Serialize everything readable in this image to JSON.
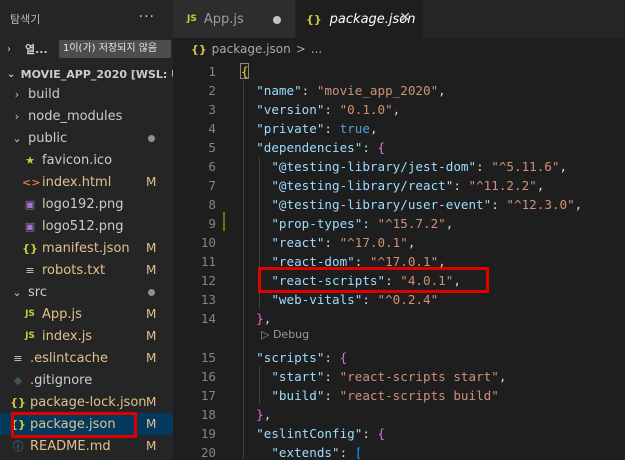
{
  "sidebar": {
    "title": "탐색기",
    "more": "···",
    "open_editors": {
      "label": "열...",
      "badge": "1이(가) 저장되지 않음"
    },
    "project": "MOVIE_APP_2020 [WSL: U...",
    "items": [
      {
        "name": "build",
        "chev": "›",
        "icon": "",
        "status": ""
      },
      {
        "name": "node_modules",
        "chev": "›",
        "icon": "",
        "status": ""
      },
      {
        "name": "public",
        "chev": "⌄",
        "icon": "",
        "status": ""
      },
      {
        "name": "favicon.ico",
        "chev": "",
        "icon": "★",
        "status": ""
      },
      {
        "name": "index.html",
        "chev": "",
        "icon": "<>",
        "status": "M"
      },
      {
        "name": "logo192.png",
        "chev": "",
        "icon": "▣",
        "status": ""
      },
      {
        "name": "logo512.png",
        "chev": "",
        "icon": "▣",
        "status": ""
      },
      {
        "name": "manifest.json",
        "chev": "",
        "icon": "{}",
        "status": "M"
      },
      {
        "name": "robots.txt",
        "chev": "",
        "icon": "≡",
        "status": "M"
      },
      {
        "name": "src",
        "chev": "⌄",
        "icon": "",
        "status": ""
      },
      {
        "name": "App.js",
        "chev": "",
        "icon": "JS",
        "status": "M"
      },
      {
        "name": "index.js",
        "chev": "",
        "icon": "JS",
        "status": "M"
      },
      {
        "name": ".eslintcache",
        "chev": "",
        "icon": "≡",
        "status": "M"
      },
      {
        "name": ".gitignore",
        "chev": "",
        "icon": "◆",
        "status": ""
      },
      {
        "name": "package-lock.json",
        "chev": "",
        "icon": "{}",
        "status": "M"
      },
      {
        "name": "package.json",
        "chev": "",
        "icon": "{}",
        "status": "M"
      },
      {
        "name": "README.md",
        "chev": "",
        "icon": "ⓘ",
        "status": "M"
      }
    ]
  },
  "tabs": [
    {
      "icon": "JS",
      "label": "App.js"
    },
    {
      "icon": "{}",
      "label": "package.json",
      "close": "✕"
    }
  ],
  "breadcrumb": {
    "icon": "{}",
    "file": "package.json",
    "sep": ">",
    "rest": "..."
  },
  "codelens": "▷ Debug",
  "code_lines": [
    {
      "n": "1",
      "parts": [
        [
          "br1",
          "{"
        ]
      ]
    },
    {
      "n": "2",
      "parts": [
        [
          "p",
          "  "
        ],
        [
          "k",
          "\"name\""
        ],
        [
          "p",
          ": "
        ],
        [
          "s",
          "\"movie_app_2020\""
        ],
        [
          "p",
          ","
        ]
      ]
    },
    {
      "n": "3",
      "parts": [
        [
          "p",
          "  "
        ],
        [
          "k",
          "\"version\""
        ],
        [
          "p",
          ": "
        ],
        [
          "s",
          "\"0.1.0\""
        ],
        [
          "p",
          ","
        ]
      ]
    },
    {
      "n": "4",
      "parts": [
        [
          "p",
          "  "
        ],
        [
          "k",
          "\"private\""
        ],
        [
          "p",
          ": "
        ],
        [
          "b",
          "true"
        ],
        [
          "p",
          ","
        ]
      ]
    },
    {
      "n": "5",
      "parts": [
        [
          "p",
          "  "
        ],
        [
          "k",
          "\"dependencies\""
        ],
        [
          "p",
          ": "
        ],
        [
          "br2",
          "{"
        ]
      ]
    },
    {
      "n": "6",
      "parts": [
        [
          "p",
          "    "
        ],
        [
          "k",
          "\"@testing-library/jest-dom\""
        ],
        [
          "p",
          ": "
        ],
        [
          "s",
          "\"^5.11.6\""
        ],
        [
          "p",
          ","
        ]
      ]
    },
    {
      "n": "7",
      "parts": [
        [
          "p",
          "    "
        ],
        [
          "k",
          "\"@testing-library/react\""
        ],
        [
          "p",
          ": "
        ],
        [
          "s",
          "\"^11.2.2\""
        ],
        [
          "p",
          ","
        ]
      ]
    },
    {
      "n": "8",
      "parts": [
        [
          "p",
          "    "
        ],
        [
          "k",
          "\"@testing-library/user-event\""
        ],
        [
          "p",
          ": "
        ],
        [
          "s",
          "\"^12.3.0\""
        ],
        [
          "p",
          ","
        ]
      ]
    },
    {
      "n": "9",
      "parts": [
        [
          "p",
          "    "
        ],
        [
          "k",
          "\"prop-types\""
        ],
        [
          "p",
          ": "
        ],
        [
          "s",
          "\"^15.7.2\""
        ],
        [
          "p",
          ","
        ]
      ]
    },
    {
      "n": "10",
      "parts": [
        [
          "p",
          "    "
        ],
        [
          "k",
          "\"react\""
        ],
        [
          "p",
          ": "
        ],
        [
          "s",
          "\"^17.0.1\""
        ],
        [
          "p",
          ","
        ]
      ]
    },
    {
      "n": "11",
      "parts": [
        [
          "p",
          "    "
        ],
        [
          "k",
          "\"react-dom\""
        ],
        [
          "p",
          ": "
        ],
        [
          "s",
          "\"^17.0.1\""
        ],
        [
          "p",
          ","
        ]
      ]
    },
    {
      "n": "12",
      "parts": [
        [
          "p",
          "    "
        ],
        [
          "k",
          "\"react-scripts\""
        ],
        [
          "p",
          ": "
        ],
        [
          "s",
          "\"4.0.1\""
        ],
        [
          "p",
          ","
        ]
      ]
    },
    {
      "n": "13",
      "parts": [
        [
          "p",
          "    "
        ],
        [
          "k",
          "\"web-vitals\""
        ],
        [
          "p",
          ": "
        ],
        [
          "s",
          "\"^0.2.4\""
        ]
      ]
    },
    {
      "n": "14",
      "parts": [
        [
          "p",
          "  "
        ],
        [
          "br2",
          "}"
        ],
        [
          "p",
          ","
        ]
      ]
    },
    {
      "n": "15",
      "parts": [
        [
          "p",
          "  "
        ],
        [
          "k",
          "\"scripts\""
        ],
        [
          "p",
          ": "
        ],
        [
          "br2",
          "{"
        ]
      ]
    },
    {
      "n": "16",
      "parts": [
        [
          "p",
          "    "
        ],
        [
          "k",
          "\"start\""
        ],
        [
          "p",
          ": "
        ],
        [
          "s",
          "\"react-scripts start\""
        ],
        [
          "p",
          ","
        ]
      ]
    },
    {
      "n": "17",
      "parts": [
        [
          "p",
          "    "
        ],
        [
          "k",
          "\"build\""
        ],
        [
          "p",
          ": "
        ],
        [
          "s",
          "\"react-scripts build\""
        ]
      ]
    },
    {
      "n": "18",
      "parts": [
        [
          "p",
          "  "
        ],
        [
          "br2",
          "}"
        ],
        [
          "p",
          ","
        ]
      ]
    },
    {
      "n": "19",
      "parts": [
        [
          "p",
          "  "
        ],
        [
          "k",
          "\"eslintConfig\""
        ],
        [
          "p",
          ": "
        ],
        [
          "br2",
          "{"
        ]
      ]
    },
    {
      "n": "20",
      "parts": [
        [
          "p",
          "    "
        ],
        [
          "k",
          "\"extends\""
        ],
        [
          "p",
          ": "
        ],
        [
          "br3",
          "["
        ]
      ]
    }
  ]
}
